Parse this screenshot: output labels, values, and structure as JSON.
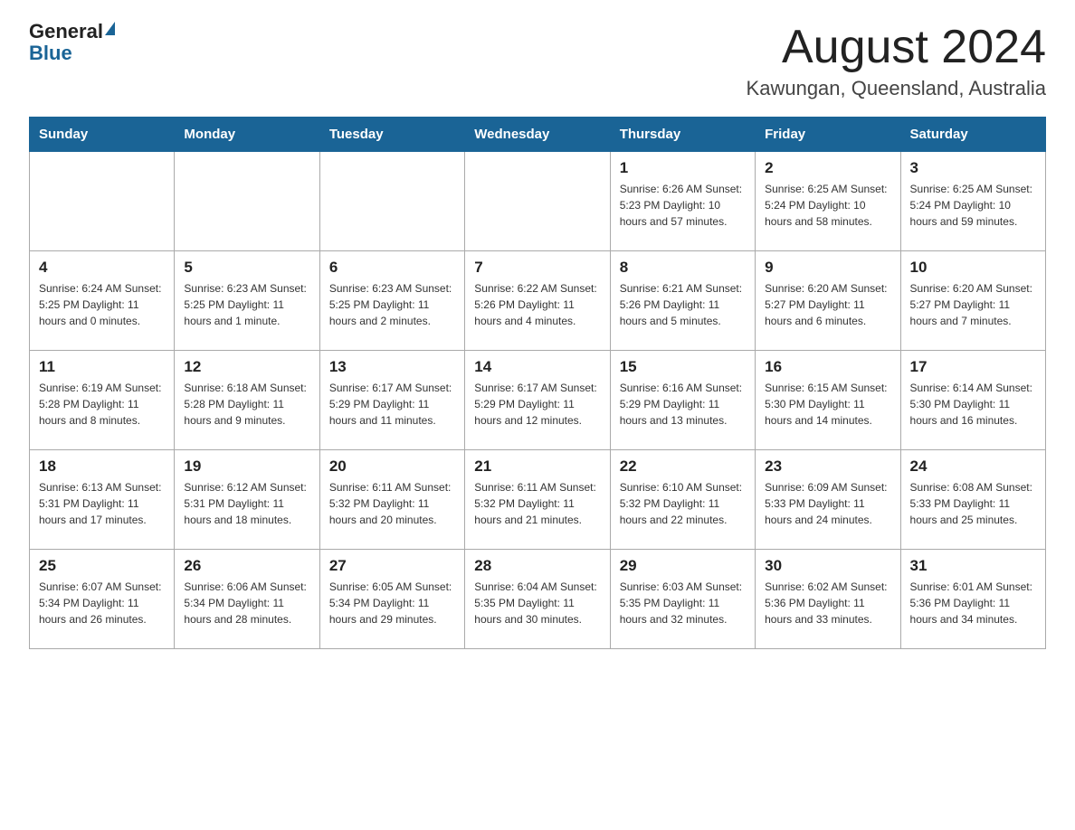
{
  "header": {
    "logo_general": "General",
    "logo_blue": "Blue",
    "title": "August 2024",
    "subtitle": "Kawungan, Queensland, Australia"
  },
  "days_of_week": [
    "Sunday",
    "Monday",
    "Tuesday",
    "Wednesday",
    "Thursday",
    "Friday",
    "Saturday"
  ],
  "weeks": [
    {
      "days": [
        {
          "number": "",
          "info": ""
        },
        {
          "number": "",
          "info": ""
        },
        {
          "number": "",
          "info": ""
        },
        {
          "number": "",
          "info": ""
        },
        {
          "number": "1",
          "info": "Sunrise: 6:26 AM\nSunset: 5:23 PM\nDaylight: 10 hours\nand 57 minutes."
        },
        {
          "number": "2",
          "info": "Sunrise: 6:25 AM\nSunset: 5:24 PM\nDaylight: 10 hours\nand 58 minutes."
        },
        {
          "number": "3",
          "info": "Sunrise: 6:25 AM\nSunset: 5:24 PM\nDaylight: 10 hours\nand 59 minutes."
        }
      ]
    },
    {
      "days": [
        {
          "number": "4",
          "info": "Sunrise: 6:24 AM\nSunset: 5:25 PM\nDaylight: 11 hours\nand 0 minutes."
        },
        {
          "number": "5",
          "info": "Sunrise: 6:23 AM\nSunset: 5:25 PM\nDaylight: 11 hours\nand 1 minute."
        },
        {
          "number": "6",
          "info": "Sunrise: 6:23 AM\nSunset: 5:25 PM\nDaylight: 11 hours\nand 2 minutes."
        },
        {
          "number": "7",
          "info": "Sunrise: 6:22 AM\nSunset: 5:26 PM\nDaylight: 11 hours\nand 4 minutes."
        },
        {
          "number": "8",
          "info": "Sunrise: 6:21 AM\nSunset: 5:26 PM\nDaylight: 11 hours\nand 5 minutes."
        },
        {
          "number": "9",
          "info": "Sunrise: 6:20 AM\nSunset: 5:27 PM\nDaylight: 11 hours\nand 6 minutes."
        },
        {
          "number": "10",
          "info": "Sunrise: 6:20 AM\nSunset: 5:27 PM\nDaylight: 11 hours\nand 7 minutes."
        }
      ]
    },
    {
      "days": [
        {
          "number": "11",
          "info": "Sunrise: 6:19 AM\nSunset: 5:28 PM\nDaylight: 11 hours\nand 8 minutes."
        },
        {
          "number": "12",
          "info": "Sunrise: 6:18 AM\nSunset: 5:28 PM\nDaylight: 11 hours\nand 9 minutes."
        },
        {
          "number": "13",
          "info": "Sunrise: 6:17 AM\nSunset: 5:29 PM\nDaylight: 11 hours\nand 11 minutes."
        },
        {
          "number": "14",
          "info": "Sunrise: 6:17 AM\nSunset: 5:29 PM\nDaylight: 11 hours\nand 12 minutes."
        },
        {
          "number": "15",
          "info": "Sunrise: 6:16 AM\nSunset: 5:29 PM\nDaylight: 11 hours\nand 13 minutes."
        },
        {
          "number": "16",
          "info": "Sunrise: 6:15 AM\nSunset: 5:30 PM\nDaylight: 11 hours\nand 14 minutes."
        },
        {
          "number": "17",
          "info": "Sunrise: 6:14 AM\nSunset: 5:30 PM\nDaylight: 11 hours\nand 16 minutes."
        }
      ]
    },
    {
      "days": [
        {
          "number": "18",
          "info": "Sunrise: 6:13 AM\nSunset: 5:31 PM\nDaylight: 11 hours\nand 17 minutes."
        },
        {
          "number": "19",
          "info": "Sunrise: 6:12 AM\nSunset: 5:31 PM\nDaylight: 11 hours\nand 18 minutes."
        },
        {
          "number": "20",
          "info": "Sunrise: 6:11 AM\nSunset: 5:32 PM\nDaylight: 11 hours\nand 20 minutes."
        },
        {
          "number": "21",
          "info": "Sunrise: 6:11 AM\nSunset: 5:32 PM\nDaylight: 11 hours\nand 21 minutes."
        },
        {
          "number": "22",
          "info": "Sunrise: 6:10 AM\nSunset: 5:32 PM\nDaylight: 11 hours\nand 22 minutes."
        },
        {
          "number": "23",
          "info": "Sunrise: 6:09 AM\nSunset: 5:33 PM\nDaylight: 11 hours\nand 24 minutes."
        },
        {
          "number": "24",
          "info": "Sunrise: 6:08 AM\nSunset: 5:33 PM\nDaylight: 11 hours\nand 25 minutes."
        }
      ]
    },
    {
      "days": [
        {
          "number": "25",
          "info": "Sunrise: 6:07 AM\nSunset: 5:34 PM\nDaylight: 11 hours\nand 26 minutes."
        },
        {
          "number": "26",
          "info": "Sunrise: 6:06 AM\nSunset: 5:34 PM\nDaylight: 11 hours\nand 28 minutes."
        },
        {
          "number": "27",
          "info": "Sunrise: 6:05 AM\nSunset: 5:34 PM\nDaylight: 11 hours\nand 29 minutes."
        },
        {
          "number": "28",
          "info": "Sunrise: 6:04 AM\nSunset: 5:35 PM\nDaylight: 11 hours\nand 30 minutes."
        },
        {
          "number": "29",
          "info": "Sunrise: 6:03 AM\nSunset: 5:35 PM\nDaylight: 11 hours\nand 32 minutes."
        },
        {
          "number": "30",
          "info": "Sunrise: 6:02 AM\nSunset: 5:36 PM\nDaylight: 11 hours\nand 33 minutes."
        },
        {
          "number": "31",
          "info": "Sunrise: 6:01 AM\nSunset: 5:36 PM\nDaylight: 11 hours\nand 34 minutes."
        }
      ]
    }
  ]
}
